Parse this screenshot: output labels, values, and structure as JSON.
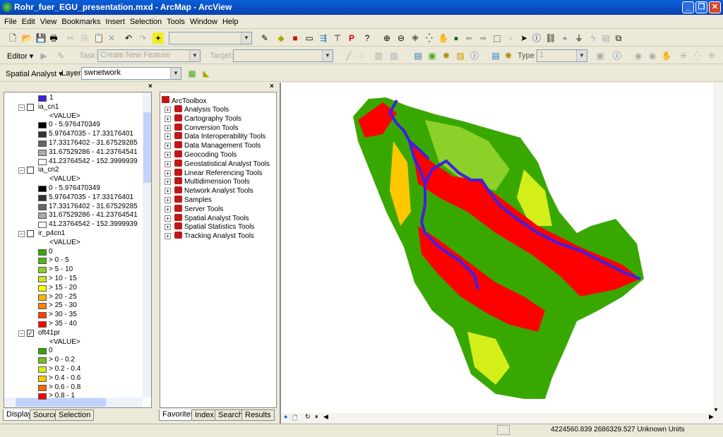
{
  "window": {
    "title": "Rohr_fuer_EGU_presentation.mxd - ArcMap - ArcView"
  },
  "menu": [
    "File",
    "Edit",
    "View",
    "Bookmarks",
    "Insert",
    "Selection",
    "Tools",
    "Window",
    "Help"
  ],
  "editor": {
    "label": "Editor",
    "task_label": "Task:",
    "task_value": "Create New Feature",
    "target_label": "Target:",
    "type_label": "Type",
    "type_value": "1"
  },
  "spatial_analyst": {
    "label": "Spatial Analyst",
    "layer_label": "Layer:",
    "layer_value": "swnetwork"
  },
  "toc": {
    "top_item": "1",
    "layers": [
      {
        "name": "ia_cn1",
        "checked": false,
        "field": "<VALUE>",
        "classes": [
          {
            "label": "0 - 5.976470349",
            "color": "#000000"
          },
          {
            "label": "5.97647035 - 17.33176401",
            "color": "#333333"
          },
          {
            "label": "17.33176402 - 31.67529285",
            "color": "#666666"
          },
          {
            "label": "31.67529286 - 41.23764541",
            "color": "#aaaaaa"
          },
          {
            "label": "41.23764542 - 152.3999939",
            "color": "#ffffff"
          }
        ]
      },
      {
        "name": "ia_cn2",
        "checked": false,
        "field": "<VALUE>",
        "classes": [
          {
            "label": "0 - 5.976470349",
            "color": "#000000"
          },
          {
            "label": "5.97647035 - 17.33176401",
            "color": "#333333"
          },
          {
            "label": "17.33176402 - 31.67529285",
            "color": "#666666"
          },
          {
            "label": "31.67529286 - 41.23764541",
            "color": "#aaaaaa"
          },
          {
            "label": "41.23764542 - 152.3999939",
            "color": "#ffffff"
          }
        ]
      },
      {
        "name": "ir_p4cn1",
        "checked": false,
        "field": "<VALUE>",
        "classes": [
          {
            "label": "0",
            "color": "#38a800"
          },
          {
            "label": "> 0 - 5",
            "color": "#4cb814"
          },
          {
            "label": "> 5 - 10",
            "color": "#8cd02a"
          },
          {
            "label": "> 10 - 15",
            "color": "#c8e61e"
          },
          {
            "label": "> 15 - 20",
            "color": "#ffff00"
          },
          {
            "label": "> 20 - 25",
            "color": "#ffb400"
          },
          {
            "label": "> 25 - 30",
            "color": "#ff8000"
          },
          {
            "label": "> 30 - 35",
            "color": "#ff4000"
          },
          {
            "label": "> 35 - 40",
            "color": "#ff0000"
          }
        ]
      },
      {
        "name": "oft41pr",
        "checked": true,
        "field": "<VALUE>",
        "classes": [
          {
            "label": "0",
            "color": "#38a800"
          },
          {
            "label": "> 0 - 0.2",
            "color": "#70c020"
          },
          {
            "label": "> 0.2 - 0.4",
            "color": "#d4ee1a"
          },
          {
            "label": "> 0.4 - 0.6",
            "color": "#ffc800"
          },
          {
            "label": "> 0.6 - 0.8",
            "color": "#ff6a00"
          },
          {
            "label": "> 0.8 - 1",
            "color": "#ff0000"
          }
        ]
      }
    ],
    "tabs": [
      "Display",
      "Source",
      "Selection"
    ]
  },
  "toolbox": {
    "root": "ArcToolbox",
    "items": [
      "Analysis Tools",
      "Cartography Tools",
      "Conversion Tools",
      "Data Interoperability Tools",
      "Data Management Tools",
      "Geocoding Tools",
      "Geostatistical Analyst Tools",
      "Linear Referencing Tools",
      "Multidimension Tools",
      "Network Analyst Tools",
      "Samples",
      "Server Tools",
      "Spatial Analyst Tools",
      "Spatial Statistics Tools",
      "Tracking Analyst Tools"
    ],
    "tabs": [
      "Favorites",
      "Index",
      "Search",
      "Results"
    ]
  },
  "status": {
    "coordinates": "4224560.839  2686329.527 Unknown Units"
  },
  "colors": {
    "river": "#4020e0",
    "green": "#38a800",
    "red": "#ff0000",
    "yellow": "#d4ee1a",
    "orange": "#ffc800"
  }
}
